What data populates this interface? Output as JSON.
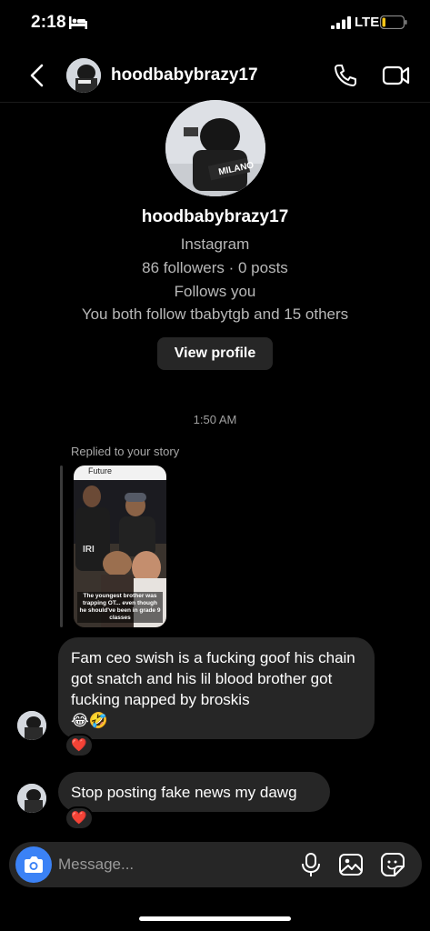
{
  "status_bar": {
    "time": "2:18",
    "network": "LTE",
    "icons": [
      "bed-icon",
      "signal-icon",
      "battery-icon"
    ]
  },
  "header": {
    "username": "hoodbabybrazy17",
    "icons": [
      "back-chevron-icon",
      "phone-icon",
      "video-camera-icon"
    ]
  },
  "profile": {
    "username": "hoodbabybrazy17",
    "platform": "Instagram",
    "stats": "86 followers · 0 posts",
    "follows_you": "Follows you",
    "mutual": "You both follow tbabytgb and 15 others",
    "view_profile_label": "View profile",
    "avatar_text": "MILANO"
  },
  "conversation": {
    "timestamp": "1:50 AM",
    "story_reply": {
      "label": "Replied to your story",
      "story_top_label": "Future",
      "story_caption": "The youngest brother was trapping OT... even though he should've been in grade 9 classes"
    },
    "messages": [
      {
        "text": "Fam ceo swish is a fucking goof his chain got snatch and his lil blood brother got fucking napped by broskis",
        "emojis": "😂🤣",
        "reaction": "❤️"
      },
      {
        "text": "Stop posting fake news my dawg",
        "reaction": "❤️"
      }
    ]
  },
  "composer": {
    "placeholder": "Message...",
    "icons": [
      "camera-icon",
      "microphone-icon",
      "gallery-icon",
      "sticker-icon"
    ]
  },
  "colors": {
    "background": "#000000",
    "bubble": "#262626",
    "camera_button": "#3b82f6",
    "reaction_heart": "#ed2a46"
  }
}
